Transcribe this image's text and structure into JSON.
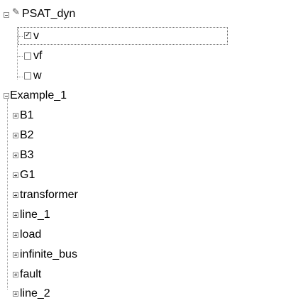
{
  "tree": {
    "root1": {
      "label": "PSAT_dyn",
      "icon": "probe-icon",
      "children": [
        {
          "label": "v",
          "checked": true
        },
        {
          "label": "vf",
          "checked": false
        },
        {
          "label": "w",
          "checked": false
        }
      ]
    },
    "root2": {
      "label": "Example_1",
      "children": [
        {
          "label": "B1"
        },
        {
          "label": "B2"
        },
        {
          "label": "B3"
        },
        {
          "label": "G1"
        },
        {
          "label": "transformer"
        },
        {
          "label": "line_1"
        },
        {
          "label": "load"
        },
        {
          "label": "infinite_bus"
        },
        {
          "label": "fault"
        },
        {
          "label": "line_2"
        }
      ]
    }
  }
}
